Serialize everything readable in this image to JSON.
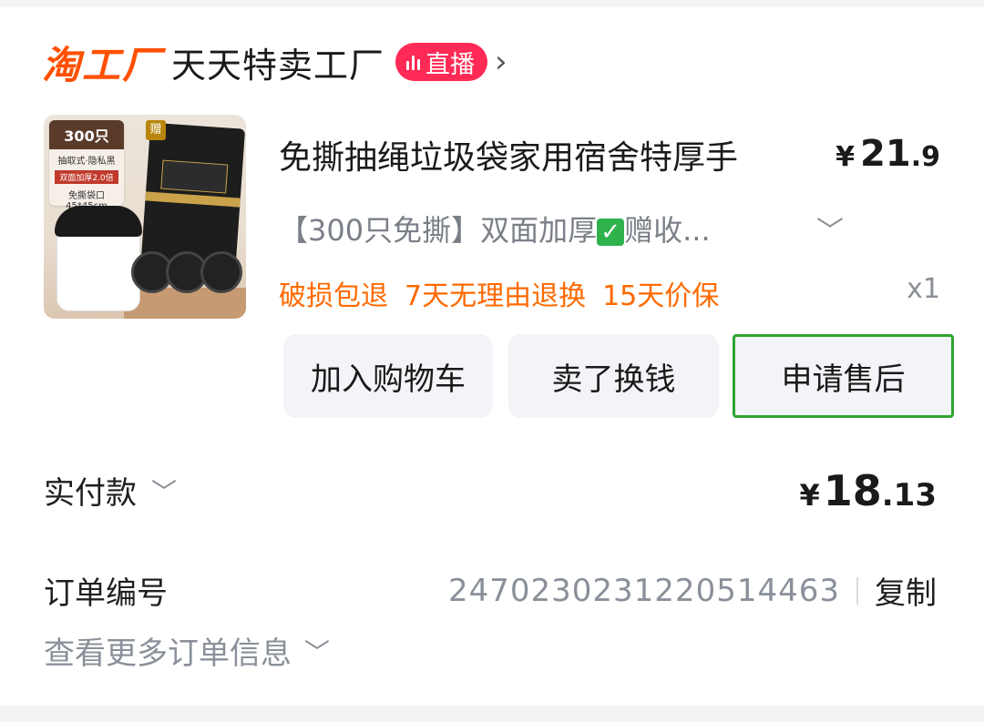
{
  "shop": {
    "brand": "淘工厂",
    "name": "天天特卖工厂",
    "live_badge": "直播",
    "arrow": "›"
  },
  "product": {
    "title": "免撕抽绳垃圾袋家用宿舍特厚手",
    "price_symbol": "¥",
    "price_int": "21",
    "price_dec": ".9",
    "sku_text_before": "【300只免撕】双面加厚",
    "sku_text_after": "赠收...",
    "sku_check_icon": "✓",
    "services": [
      "破损包退",
      "7天无理由退换",
      "15天价保"
    ],
    "quantity": "x1",
    "thumb": {
      "count": "300只",
      "line1": "抽取式·隐私黑",
      "tag": "双面加厚2.0倍",
      "line2": "免撕袋口45*45cm",
      "gift": "赠"
    }
  },
  "actions": {
    "add_to_cart": "加入购物车",
    "sell_for_cash": "卖了换钱",
    "after_sales": "申请售后"
  },
  "payment": {
    "label": "实付款",
    "symbol": "¥",
    "amount_int": "18",
    "amount_dec": ".13"
  },
  "order": {
    "label": "订单编号",
    "number": "2470230231220514463",
    "copy_label": "复制",
    "more_info": "查看更多订单信息"
  },
  "colors": {
    "brand": "#ff5000",
    "live": "#ff2a55",
    "service": "#ff6a00",
    "highlight_border": "#2fa32f"
  }
}
